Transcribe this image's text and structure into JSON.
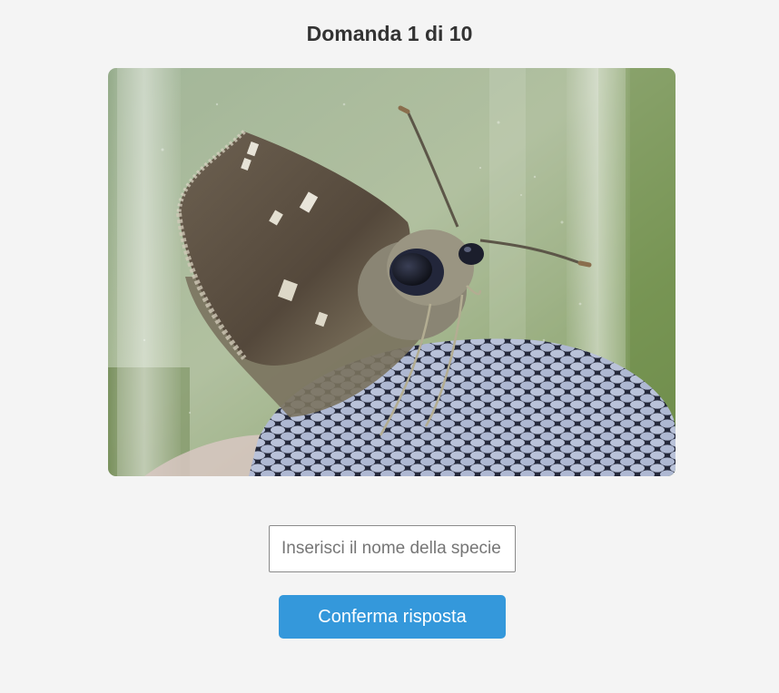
{
  "quiz": {
    "question_title": "Domanda 1 di 10",
    "current_question": 1,
    "total_questions": 10
  },
  "photo": {
    "subject": "butterfly-on-mesh-in-glass-tube"
  },
  "answer": {
    "placeholder": "Inserisci il nome della specie",
    "value": ""
  },
  "actions": {
    "confirm_label": "Conferma risposta"
  },
  "colors": {
    "background": "#f4f4f4",
    "title_text": "#333333",
    "button_bg": "#3498db",
    "button_text": "#ffffff"
  }
}
